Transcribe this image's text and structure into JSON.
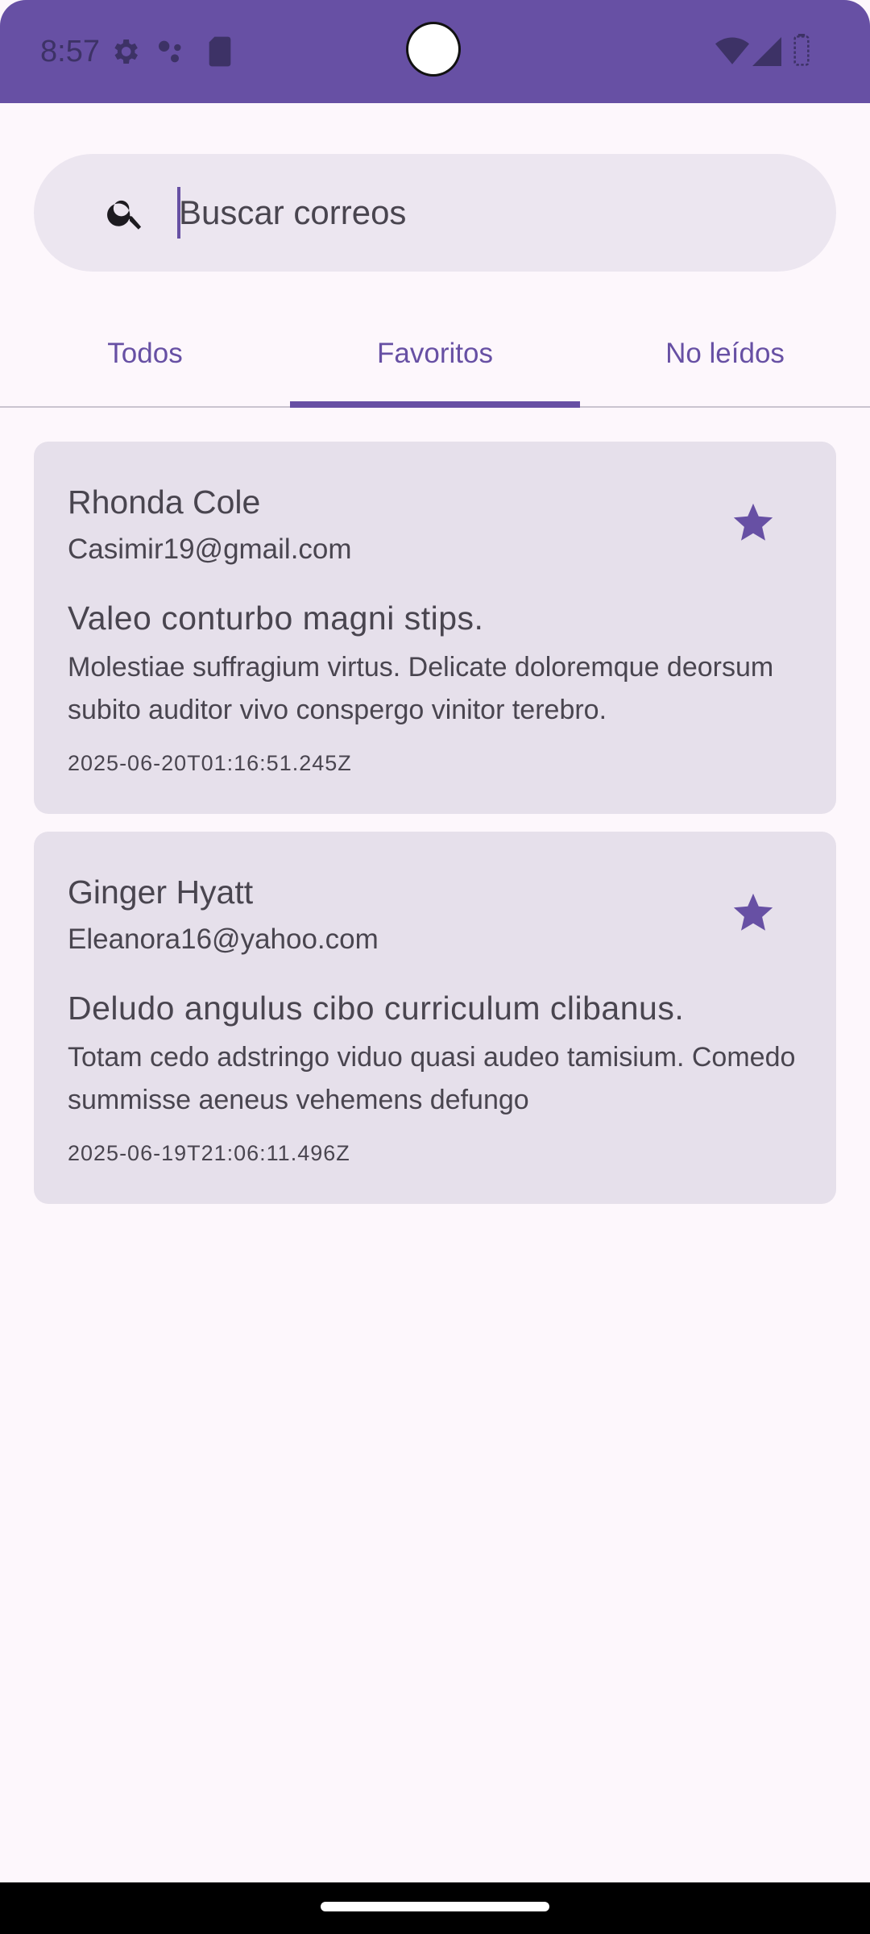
{
  "status_bar": {
    "time": "8:57",
    "icons": [
      "settings-gear-icon",
      "assistant-dots-icon",
      "sd-card-icon",
      "wifi-icon",
      "cellular-signal-icon",
      "battery-icon"
    ]
  },
  "search": {
    "placeholder": "Buscar correos",
    "value": "",
    "icon": "search-icon"
  },
  "tabs": [
    {
      "label": "Todos",
      "selected": false
    },
    {
      "label": "Favoritos",
      "selected": true
    },
    {
      "label": "No leídos",
      "selected": false
    }
  ],
  "emails": [
    {
      "name": "Rhonda Cole",
      "email": "Casimir19@gmail.com",
      "subject": "Valeo conturbo magni stips.",
      "body": "Molestiae suffragium virtus. Delicate doloremque deorsum subito auditor vivo conspergo vinitor terebro.",
      "date": "2025-06-20T01:16:51.245Z",
      "starred": true
    },
    {
      "name": "Ginger Hyatt",
      "email": "Eleanora16@yahoo.com",
      "subject": "Deludo angulus cibo curriculum clibanus.",
      "body": "Totam cedo adstringo viduo quasi audeo tamisium. Comedo summisse aeneus vehemens defungo",
      "date": "2025-06-19T21:06:11.496Z",
      "starred": true
    }
  ],
  "colors": {
    "primary": "#6750a4",
    "surface": "#fdf7fc",
    "card": "#e6e0eb",
    "search_bg": "#ece6f0",
    "text": "#49454f"
  }
}
